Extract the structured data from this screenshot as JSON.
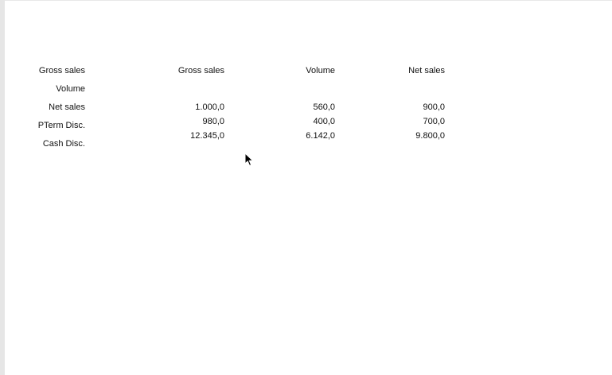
{
  "table": {
    "row_labels": [
      "Gross sales",
      "Volume",
      "Net sales",
      "PTerm Disc.",
      "Cash Disc."
    ],
    "column_headers": [
      "Gross sales",
      "Volume",
      "Net sales"
    ],
    "rows": [
      [
        "1.000,0",
        "560,0",
        "900,0"
      ],
      [
        "980,0",
        "400,0",
        "700,0"
      ],
      [
        "12.345,0",
        "6.142,0",
        "9.800,0"
      ]
    ]
  },
  "cursor": {
    "icon": "mouse-pointer-icon"
  }
}
